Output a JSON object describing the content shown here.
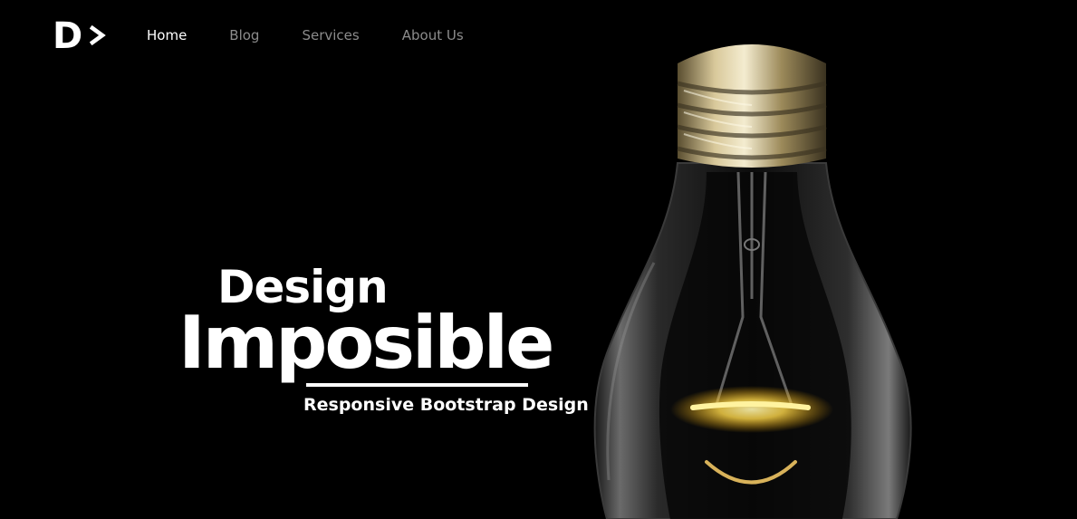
{
  "header": {
    "logo": {
      "letter": "D",
      "icon": "chevron-right-icon"
    },
    "nav": [
      {
        "label": "Home",
        "active": true
      },
      {
        "label": "Blog",
        "active": false
      },
      {
        "label": "Services",
        "active": false
      },
      {
        "label": "About Us",
        "active": false
      }
    ]
  },
  "hero": {
    "line1": "Design",
    "line2": "Imposible",
    "tagline": "Responsive Bootstrap Design",
    "image": "light-bulb-image"
  },
  "colors": {
    "background": "#000000",
    "text": "#ffffff",
    "nav_inactive": "#8c8c8c",
    "bulb_base": "#c9b98a",
    "filament_glow": "#ffd84a"
  }
}
